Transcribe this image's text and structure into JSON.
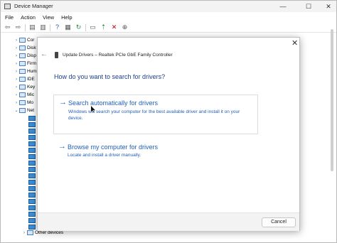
{
  "window": {
    "title": "Device Manager",
    "controls": {
      "minimize": "—",
      "maximize": "☐",
      "close": "✕"
    }
  },
  "menu": [
    "File",
    "Action",
    "View",
    "Help"
  ],
  "toolbar": [
    "back-arrow-icon",
    "forward-arrow-icon",
    "properties-icon",
    "show-hidden-icon",
    "help-icon",
    "driver-details-icon",
    "update-driver-icon",
    "monitor-icon",
    "enable-device-icon",
    "uninstall-icon",
    "scan-hardware-icon"
  ],
  "tree": {
    "items": [
      {
        "label": "Cor"
      },
      {
        "label": "Disk"
      },
      {
        "label": "Disp"
      },
      {
        "label": "Firm"
      },
      {
        "label": "Hum"
      },
      {
        "label": "IDE"
      },
      {
        "label": "Key"
      },
      {
        "label": "Mic"
      },
      {
        "label": "Mo"
      },
      {
        "label": "Net"
      }
    ],
    "network_adapter_count": 18,
    "other_devices": "Other devices"
  },
  "dialog": {
    "header": "Update Drivers – Realtek PCIe GbE Family Controller",
    "question": "How do you want to search for drivers?",
    "option_auto": {
      "title": "Search automatically for drivers",
      "desc": "Windows will search your computer for the best available driver and install it on your device."
    },
    "option_browse": {
      "title": "Browse my computer for drivers",
      "desc": "Locate and install a driver manually."
    },
    "cancel": "Cancel"
  },
  "colors": {
    "link": "#1f5fb8",
    "question": "#1a3e8c",
    "network_icon": "#3d8fd8"
  }
}
